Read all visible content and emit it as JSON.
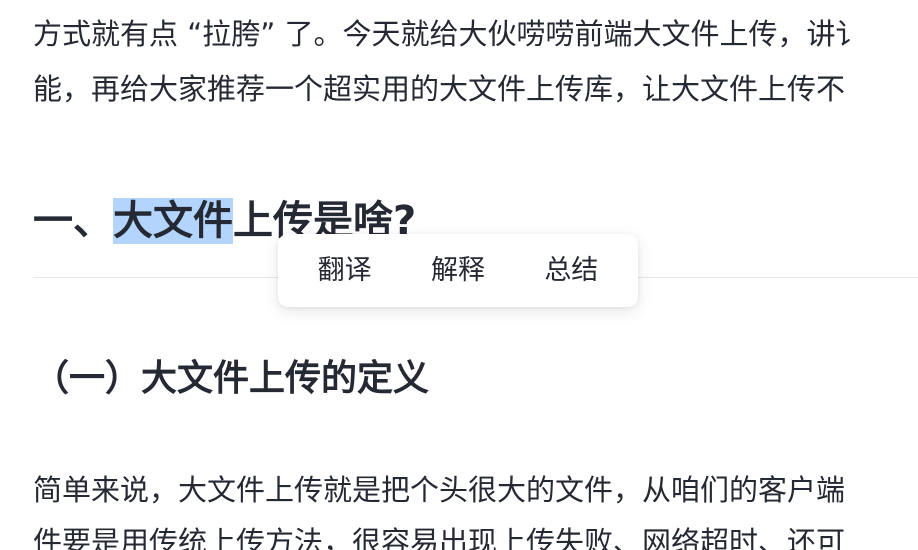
{
  "article": {
    "line1": "方式就有点 “拉胯” 了。今天就给大伙唠唠前端大文件上传，讲讠",
    "line2": "能，再给大家推荐一个超实用的大文件上传库，让大文件上传不",
    "heading2": {
      "prefix": "一、",
      "selected": "大文件",
      "suffix": "上传是啥?"
    },
    "heading3": "（一）大文件上传的定义",
    "line3": "简单来说，大文件上传就是把个头很大的文件，从咱们的客户端",
    "line4": "件要是用传统上传方法，很容易出现上传失败、网络超时、还可"
  },
  "selection_popup": {
    "translate_label": "翻译",
    "explain_label": "解释",
    "summarize_label": "总结"
  }
}
